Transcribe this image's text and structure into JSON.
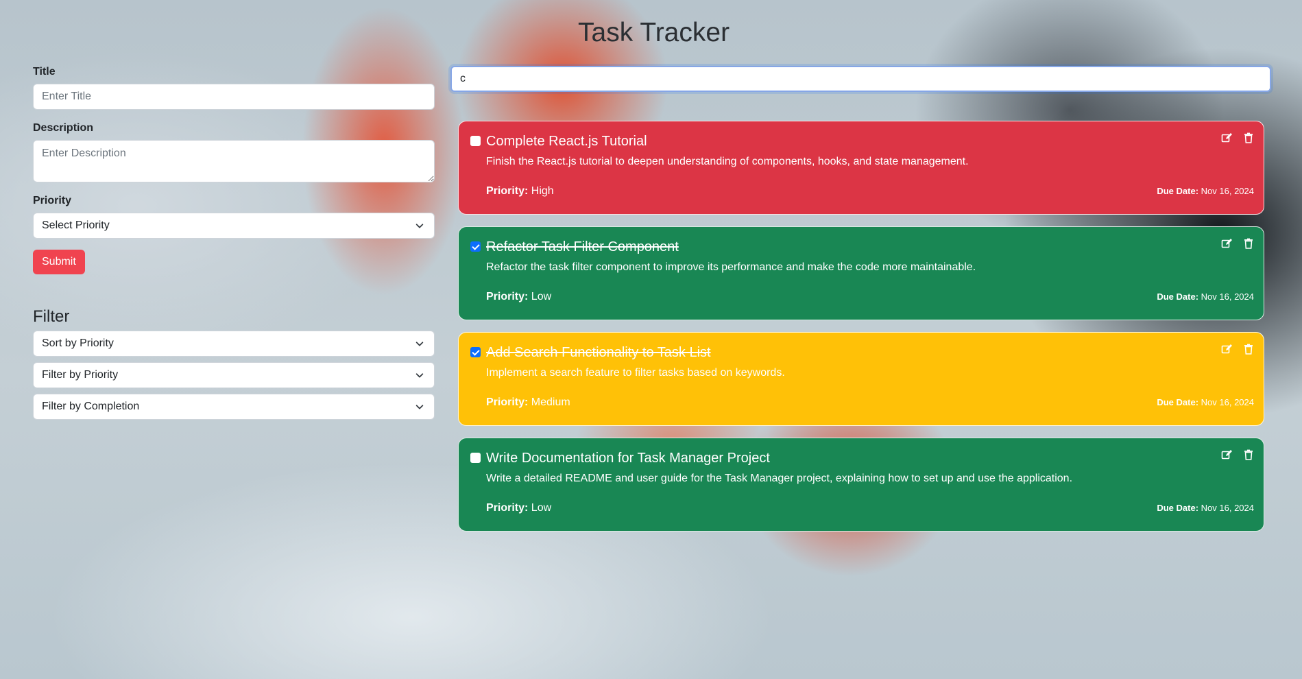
{
  "app": {
    "title": "Task Tracker"
  },
  "form": {
    "title_label": "Title",
    "title_placeholder": "Enter Title",
    "description_label": "Description",
    "description_placeholder": "Enter Description",
    "priority_label": "Priority",
    "priority_selected": "Select Priority",
    "submit_label": "Submit"
  },
  "filter": {
    "heading": "Filter",
    "sort_selected": "Sort by Priority",
    "priority_selected": "Filter by Priority",
    "completion_selected": "Filter by Completion"
  },
  "search": {
    "value": "c"
  },
  "tasks": [
    {
      "title": "Complete React.js Tutorial",
      "description": "Finish the React.js tutorial to deepen understanding of components, hooks, and state management.",
      "priority_label": "Priority:",
      "priority": "High",
      "due_label": "Due Date:",
      "due": "Nov 16, 2024",
      "completed": false,
      "color": "#dc3545"
    },
    {
      "title": "Refactor Task Filter Component",
      "description": "Refactor the task filter component to improve its performance and make the code more maintainable.",
      "priority_label": "Priority:",
      "priority": "Low",
      "due_label": "Due Date:",
      "due": "Nov 16, 2024",
      "completed": true,
      "color": "#198754"
    },
    {
      "title": "Add Search Functionality to Task List",
      "description": "Implement a search feature to filter tasks based on keywords.",
      "priority_label": "Priority:",
      "priority": "Medium",
      "due_label": "Due Date:",
      "due": "Nov 16, 2024",
      "completed": true,
      "color": "#ffc107"
    },
    {
      "title": "Write Documentation for Task Manager Project",
      "description": "Write a detailed README and user guide for the Task Manager project, explaining how to set up and use the application.",
      "priority_label": "Priority:",
      "priority": "Low",
      "due_label": "Due Date:",
      "due": "Nov 16, 2024",
      "completed": false,
      "color": "#198754"
    }
  ],
  "icons": {
    "edit": "edit-icon",
    "delete": "trash-icon",
    "dropdown": "chevron-down-icon"
  }
}
